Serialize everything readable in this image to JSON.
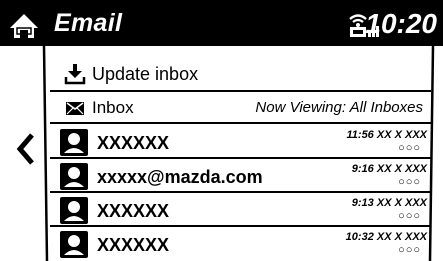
{
  "header": {
    "title": "Email",
    "time": "10:20",
    "home_icon": "home-icon",
    "status_icon": "wifi-signal-icon"
  },
  "menu": {
    "update_label": "Update inbox",
    "inbox_label": "Inbox",
    "now_viewing": "Now Viewing: All Inboxes"
  },
  "emails": [
    {
      "sender": "XXXXXX",
      "time": "11:56 XX X XXX",
      "status": "○○○"
    },
    {
      "sender": "xxxxx@mazda.com",
      "time": "9:16 XX X XXX",
      "status": "○○○"
    },
    {
      "sender": "XXXXXX",
      "time": "9:13 XX X XXX",
      "status": "○○○"
    },
    {
      "sender": "XXXXXX",
      "time": "10:32 XX X XXX",
      "status": "○○○"
    }
  ]
}
